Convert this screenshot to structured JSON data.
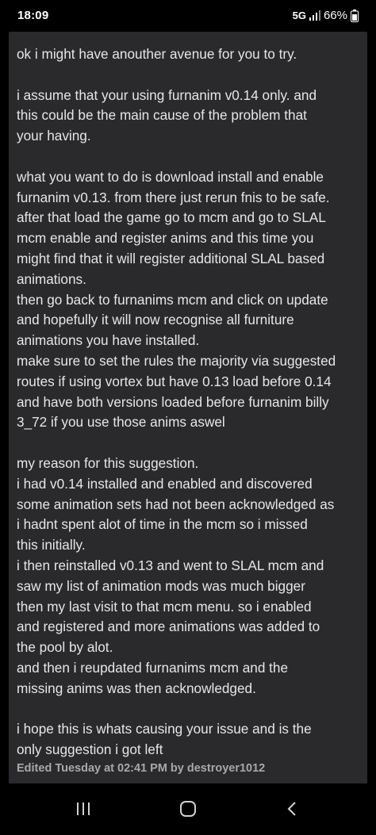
{
  "status_bar": {
    "time": "18:09",
    "network": "5G",
    "battery": "66%",
    "icons": [
      "signal-icon",
      "battery-icon"
    ]
  },
  "post": {
    "paragraphs": [
      [
        "ok i might have anouther avenue for you to try."
      ],
      [
        "i assume that your using furnanim v0.14 only. and",
        "this could be the main cause of the problem that",
        "your having."
      ],
      [
        "what you want to do is download install and enable",
        "furnanim v0.13. from there just rerun fnis to be safe.",
        "after that load the game go to mcm and go to SLAL",
        "mcm enable and register anims and this time you",
        "might find that it will register additional SLAL based",
        "animations.",
        "then go back to furnanims mcm and click on update",
        "and hopefully it will now recognise all furniture",
        "animations you have installed.",
        "make sure to set the rules the majority via suggested",
        "routes if using vortex but have 0.13 load before 0.14",
        "and have both versions loaded before furnanim billy",
        "3_72 if you use those anims aswel"
      ],
      [
        "my reason for this suggestion.",
        "i had v0.14 installed and enabled and discovered",
        "some animation sets had not been acknowledged as",
        "i hadnt spent alot of time in the mcm so i missed",
        "this initially.",
        "i then reinstalled v0.13 and went to SLAL mcm and",
        "saw my list of animation mods was much bigger",
        "then my last visit to that mcm menu. so i enabled",
        "and registered and more animations was added to",
        "the pool by alot.",
        "and then i reupdated furnanims mcm and the",
        "missing anims was then acknowledged."
      ],
      [
        "i hope this is whats causing your issue and is the",
        "only suggestion i got left"
      ]
    ],
    "edited_note": "Edited Tuesday at 02:41 PM by destroyer1012"
  },
  "nav_bar": {
    "buttons": [
      "recent-apps-icon",
      "home-icon",
      "back-icon"
    ]
  },
  "colors": {
    "background": "#000000",
    "card": "#2a2a2d",
    "text": "#e6e6e6",
    "muted": "#a8a8ac"
  }
}
